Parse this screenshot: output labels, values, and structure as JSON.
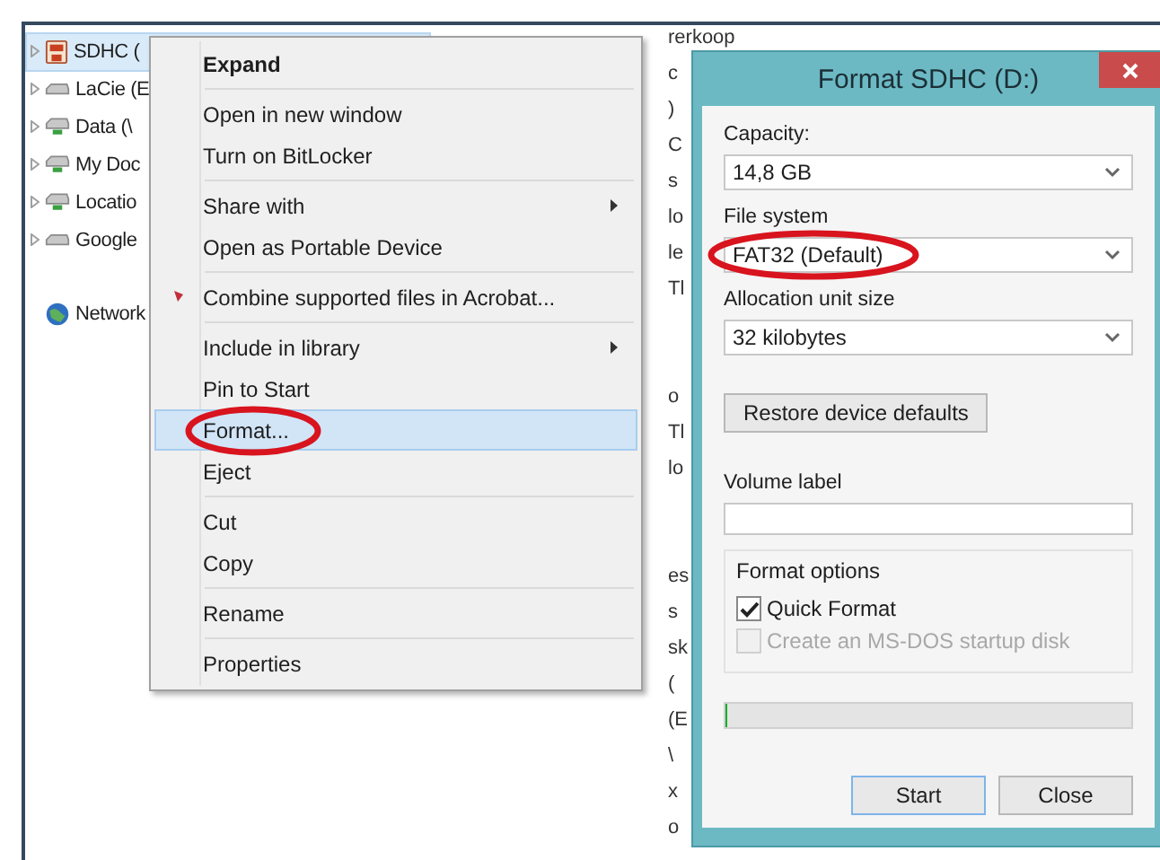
{
  "tree": {
    "items": [
      {
        "label": "SDHC (",
        "kind": "sd",
        "expandable": true,
        "selected": true
      },
      {
        "label": "LaCie (E",
        "kind": "drive",
        "expandable": true,
        "selected": false
      },
      {
        "label": "Data (\\",
        "kind": "network-drive",
        "expandable": true,
        "selected": false
      },
      {
        "label": "My Doc",
        "kind": "network-drive",
        "expandable": true,
        "selected": false
      },
      {
        "label": "Locatio",
        "kind": "network-drive",
        "expandable": true,
        "selected": false
      },
      {
        "label": "Google",
        "kind": "drive",
        "expandable": true,
        "selected": false
      },
      {
        "label": "Network",
        "kind": "network",
        "expandable": false,
        "selected": false
      }
    ]
  },
  "background_text": [
    [
      "rerkoop",
      "c",
      ")",
      "C",
      "s",
      "lo",
      "le",
      "Tl"
    ],
    [
      "o",
      "Tl",
      "lo"
    ],
    [
      "es",
      "s",
      "sk",
      "(",
      "(E",
      "\\",
      "x",
      "o"
    ]
  ],
  "context_menu": {
    "groups": [
      [
        {
          "label": "Expand",
          "kind": "default",
          "submenu": false,
          "selected": false
        }
      ],
      [
        {
          "label": "Open in new window",
          "kind": "plain",
          "submenu": false,
          "selected": false
        },
        {
          "label": "Turn on BitLocker",
          "kind": "plain",
          "submenu": false,
          "selected": false
        }
      ],
      [
        {
          "label": "Share with",
          "kind": "plain",
          "submenu": true,
          "selected": false
        },
        {
          "label": "Open as Portable Device",
          "kind": "plain",
          "submenu": false,
          "selected": false
        }
      ],
      [
        {
          "label": "Combine supported files in Acrobat...",
          "kind": "acrobat",
          "submenu": false,
          "selected": false
        }
      ],
      [
        {
          "label": "Include in library",
          "kind": "plain",
          "submenu": true,
          "selected": false
        },
        {
          "label": "Pin to Start",
          "kind": "plain",
          "submenu": false,
          "selected": false
        },
        {
          "label": "Format...",
          "kind": "plain",
          "submenu": false,
          "selected": true
        },
        {
          "label": "Eject",
          "kind": "plain",
          "submenu": false,
          "selected": false
        }
      ],
      [
        {
          "label": "Cut",
          "kind": "plain",
          "submenu": false,
          "selected": false
        },
        {
          "label": "Copy",
          "kind": "plain",
          "submenu": false,
          "selected": false
        }
      ],
      [
        {
          "label": "Rename",
          "kind": "plain",
          "submenu": false,
          "selected": false
        }
      ],
      [
        {
          "label": "Properties",
          "kind": "plain",
          "submenu": false,
          "selected": false
        }
      ]
    ]
  },
  "dialog": {
    "title": "Format SDHC (D:)",
    "dropdowns": [
      {
        "label": "Capacity:",
        "value": "14,8 GB"
      },
      {
        "label": "File system",
        "value": "FAT32 (Default)"
      },
      {
        "label": "Allocation unit size",
        "value": "32 kilobytes"
      }
    ],
    "restore_button": "Restore device defaults",
    "volume_label": {
      "label": "Volume label"
    },
    "format_options": {
      "title": "Format options",
      "options": [
        {
          "label": "Quick Format",
          "checked": true,
          "disabled": false
        },
        {
          "label": "Create an MS-DOS startup disk",
          "checked": false,
          "disabled": true
        }
      ]
    },
    "progress": {
      "level": 0
    },
    "buttons": [
      "Start",
      "Close"
    ]
  },
  "annotations": [
    {
      "kind": "ellipse"
    },
    {
      "kind": "ellipse"
    }
  ]
}
